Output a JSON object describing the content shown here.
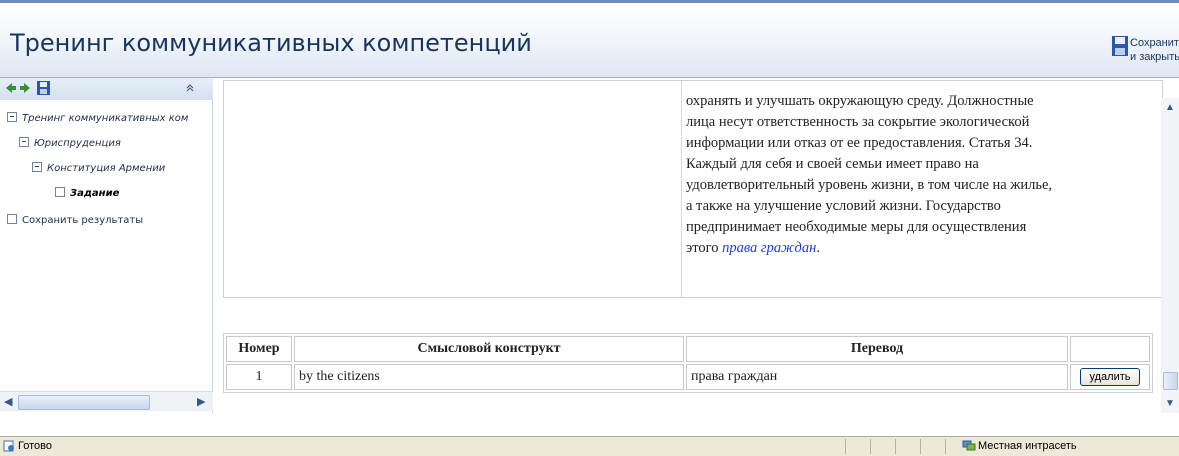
{
  "header": {
    "title": "Тренинг коммуникативных компетенций",
    "save_close_line1": "Сохранить",
    "save_close_line2": "и закрыть"
  },
  "tree": {
    "items": [
      {
        "label": "Тренинг коммуникативных ком"
      },
      {
        "label": "Юриспруденция"
      },
      {
        "label": "Конституция Армении"
      },
      {
        "label": "Задание"
      },
      {
        "label": "Сохранить результаты"
      }
    ]
  },
  "content": {
    "lines": [
      "охранять и улучшать окружающую среду. Должностные",
      "лица несут ответственность за сокрытие экологической",
      "информации или отказ от ее предоставления. Статья 34.",
      "Каждый для себя и своей семьи имеет право на",
      "удовлетворительный уровень жизни, в том числе на жилье,",
      "а также на улучшение условий жизни. Государство",
      "предпринимает необходимые меры для осуществления"
    ],
    "last_prefix": "этого",
    "link": "права граждан",
    "last_suffix": "."
  },
  "table": {
    "headers": [
      "Номер",
      "Смысловой конструкт",
      "Перевод",
      ""
    ],
    "rows": [
      {
        "num": "1",
        "construct": "by the citizens",
        "translation": "права граждан",
        "action": "удалить"
      }
    ]
  },
  "status": {
    "ready": "Готово",
    "zone": "Местная интрасеть"
  }
}
